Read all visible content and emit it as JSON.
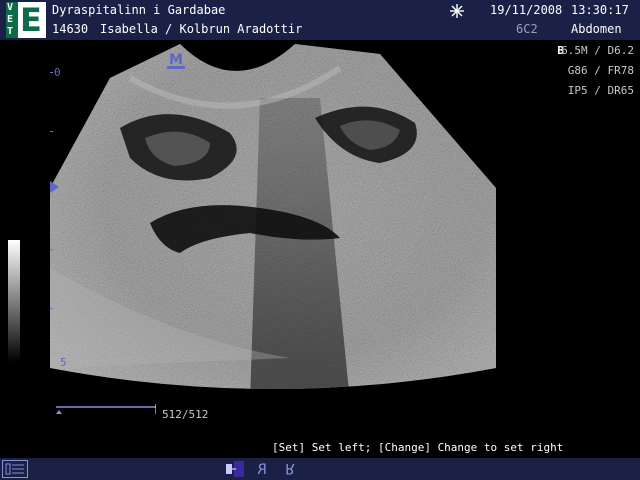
{
  "header": {
    "logo_letters": [
      "V",
      "E",
      "T"
    ],
    "hospital": "Dyraspitalinn i Gardabae",
    "patient_id": "14630",
    "patient_name": "Isabella / Kolbrun Aradottir",
    "date": "19/11/2008",
    "time": "13:30:17",
    "probe": "6C2",
    "preset": "Abdomen"
  },
  "params": {
    "mode": "B",
    "freq_depth": "6.5M / D6.2",
    "gain_frame": "G86 / FR78",
    "ip_dr": "IP5 / DR65"
  },
  "scale": {
    "depth_zero": "0",
    "depth_five": "5"
  },
  "orientation_marker": "M",
  "cine": {
    "frame": "512/512"
  },
  "status": {
    "hint": "[Set] Set left; [Change] Change to set right"
  },
  "colors": {
    "bar_bg": "#1b2146",
    "accent": "#5a69c8",
    "logo_green": "#0e6b4a"
  }
}
